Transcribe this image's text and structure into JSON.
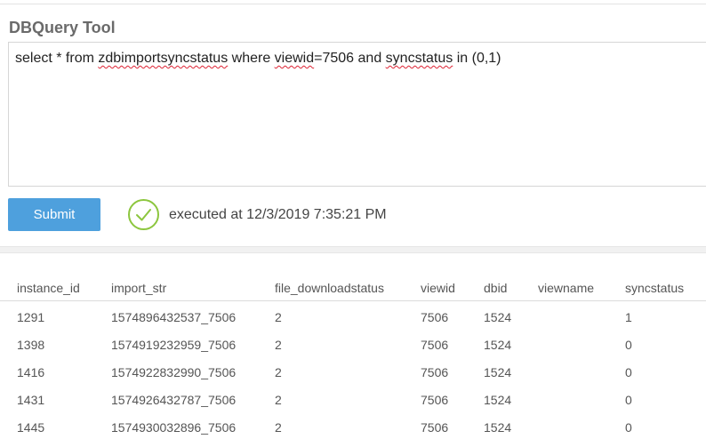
{
  "app": {
    "title": "DBQuery Tool"
  },
  "query": {
    "parts": [
      {
        "text": "select * from ",
        "spell": false
      },
      {
        "text": "zdbimportsyncstatus",
        "spell": true
      },
      {
        "text": " where ",
        "spell": false
      },
      {
        "text": "viewid",
        "spell": true
      },
      {
        "text": "=7506 and ",
        "spell": false
      },
      {
        "text": "syncstatus",
        "spell": true
      },
      {
        "text": " in (0,1)",
        "spell": false
      }
    ]
  },
  "toolbar": {
    "submit_label": "Submit"
  },
  "status": {
    "icon": "check-circle-icon",
    "text": "executed at 12/3/2019 7:35:21 PM",
    "color": "#8cc63e"
  },
  "table": {
    "columns": [
      "instance_id",
      "import_str",
      "file_downloadstatus",
      "viewid",
      "dbid",
      "viewname",
      "syncstatus"
    ],
    "rows": [
      [
        "1291",
        "1574896432537_7506",
        "2",
        "7506",
        "1524",
        "",
        "1"
      ],
      [
        "1398",
        "1574919232959_7506",
        "2",
        "7506",
        "1524",
        "",
        "0"
      ],
      [
        "1416",
        "1574922832990_7506",
        "2",
        "7506",
        "1524",
        "",
        "0"
      ],
      [
        "1431",
        "1574926432787_7506",
        "2",
        "7506",
        "1524",
        "",
        "0"
      ],
      [
        "1445",
        "1574930032896_7506",
        "2",
        "7506",
        "1524",
        "",
        "0"
      ]
    ]
  },
  "colors": {
    "accent": "#4ea0dd",
    "success": "#8cc63e"
  }
}
